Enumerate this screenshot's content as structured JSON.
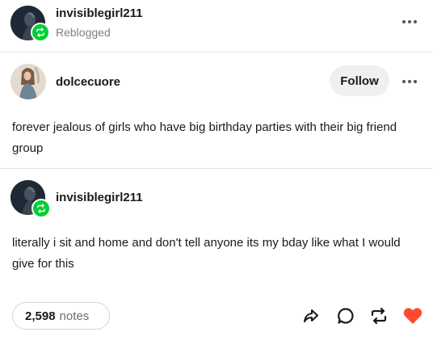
{
  "header": {
    "username": "invisiblegirl211",
    "status": "Reblogged"
  },
  "original_post": {
    "username": "dolcecuore",
    "follow_label": "Follow",
    "text": "forever jealous of girls who have big birthday parties with their big friend group"
  },
  "reblog": {
    "username": "invisiblegirl211",
    "text": "literally i sit and home and don't tell anyone its my bday like what I would give for this"
  },
  "footer": {
    "notes_count": "2,598",
    "notes_label": "notes",
    "actions": [
      "share-icon",
      "reply-icon",
      "reblog-icon",
      "like-icon"
    ]
  },
  "colors": {
    "reblog_green": "#00cf35",
    "like_red": "#ff4930",
    "divider": "#e3e3e3"
  }
}
